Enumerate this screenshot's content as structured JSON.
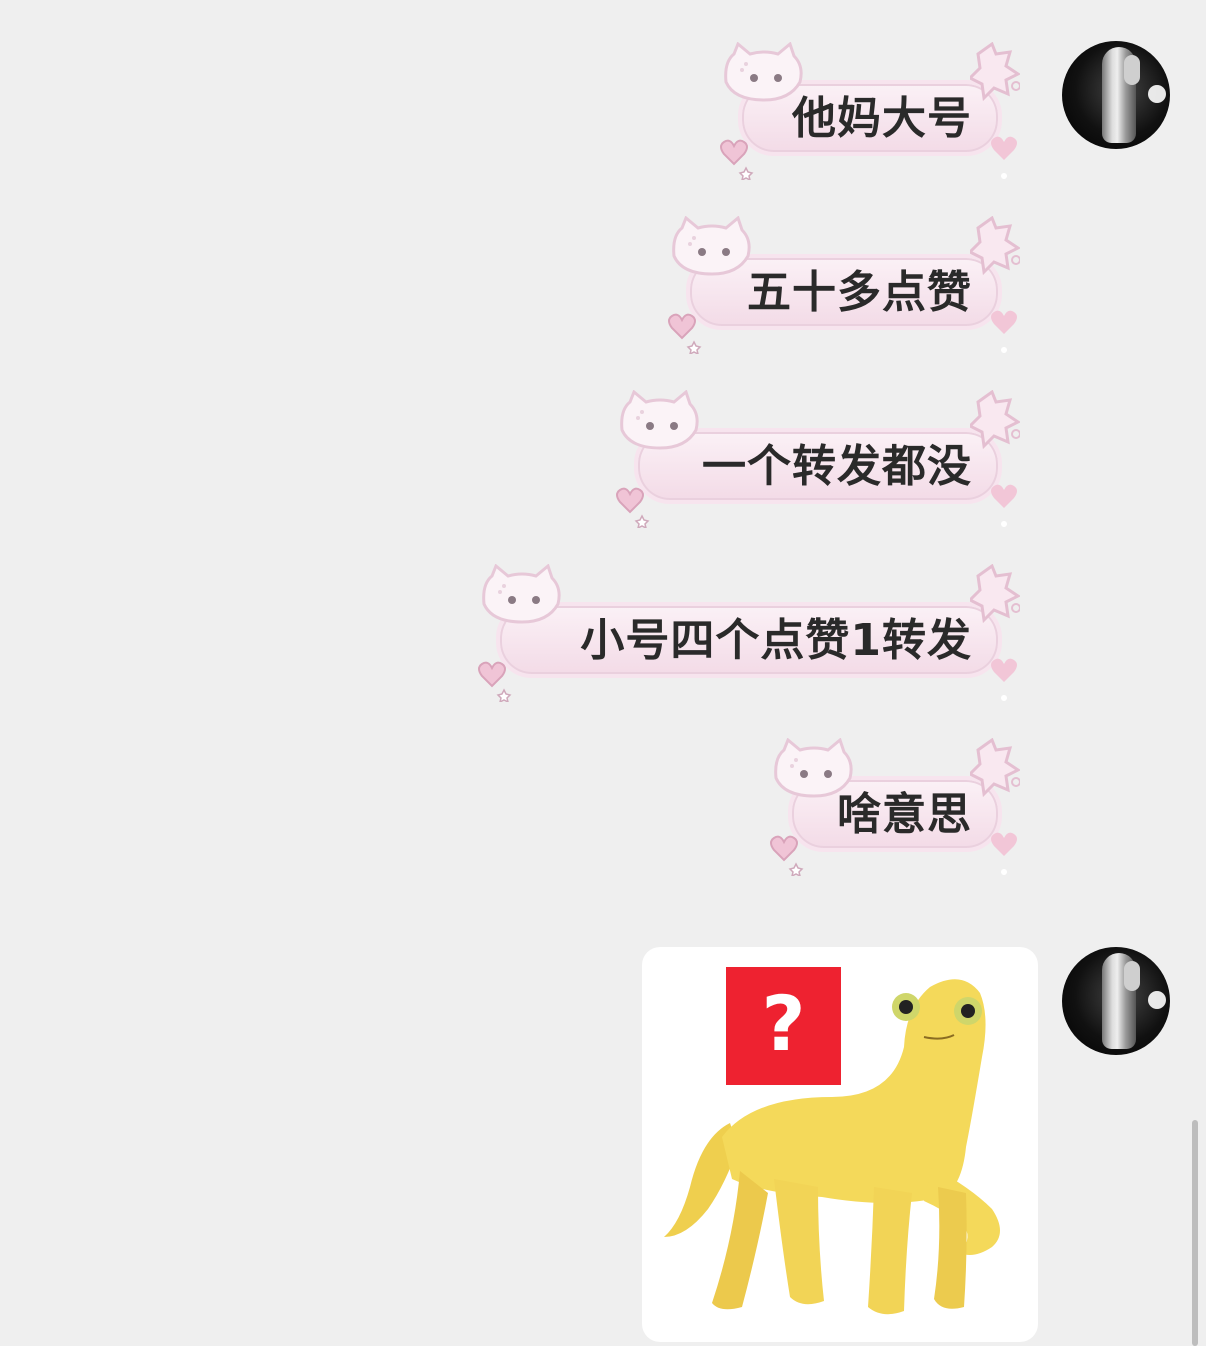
{
  "messages": [
    {
      "text": "他妈大号"
    },
    {
      "text": "五十多点赞"
    },
    {
      "text": "一个转发都没"
    },
    {
      "text": "小号四个点赞1转发"
    },
    {
      "text": "啥意思"
    }
  ],
  "sticker": {
    "badge_text": "?"
  },
  "colors": {
    "background": "#efefef",
    "bubble_pink": "#f3dbe7",
    "badge_red": "#ee2230",
    "figure_yellow": "#f4d95a"
  }
}
